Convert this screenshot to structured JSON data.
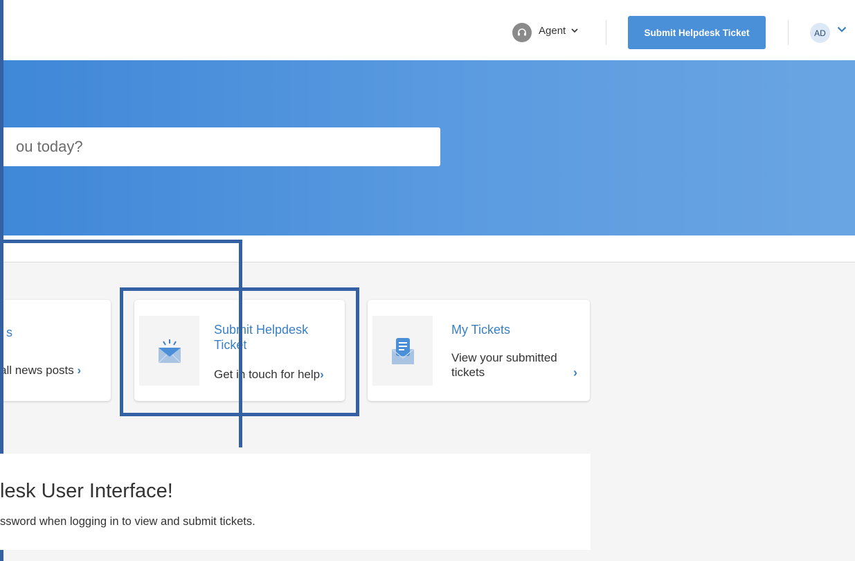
{
  "header": {
    "agent_label": "Agent",
    "submit_button": "Submit Helpdesk Ticket",
    "avatar_initials": "AD"
  },
  "hero": {
    "search_placeholder": "ou today?"
  },
  "cards": [
    {
      "title": "s",
      "description": "all news posts",
      "chevron": "›"
    },
    {
      "title": "Submit Helpdesk Ticket",
      "description": "Get in touch for help",
      "chevron": "›"
    },
    {
      "title": "My Tickets",
      "description": "View your submitted tickets",
      "chevron": "›"
    }
  ],
  "welcome": {
    "title": "lesk User Interface!",
    "text": "ssword when logging in to view and submit tickets."
  },
  "colors": {
    "accent": "#4a90d9",
    "highlight_frame": "#3461a3"
  }
}
